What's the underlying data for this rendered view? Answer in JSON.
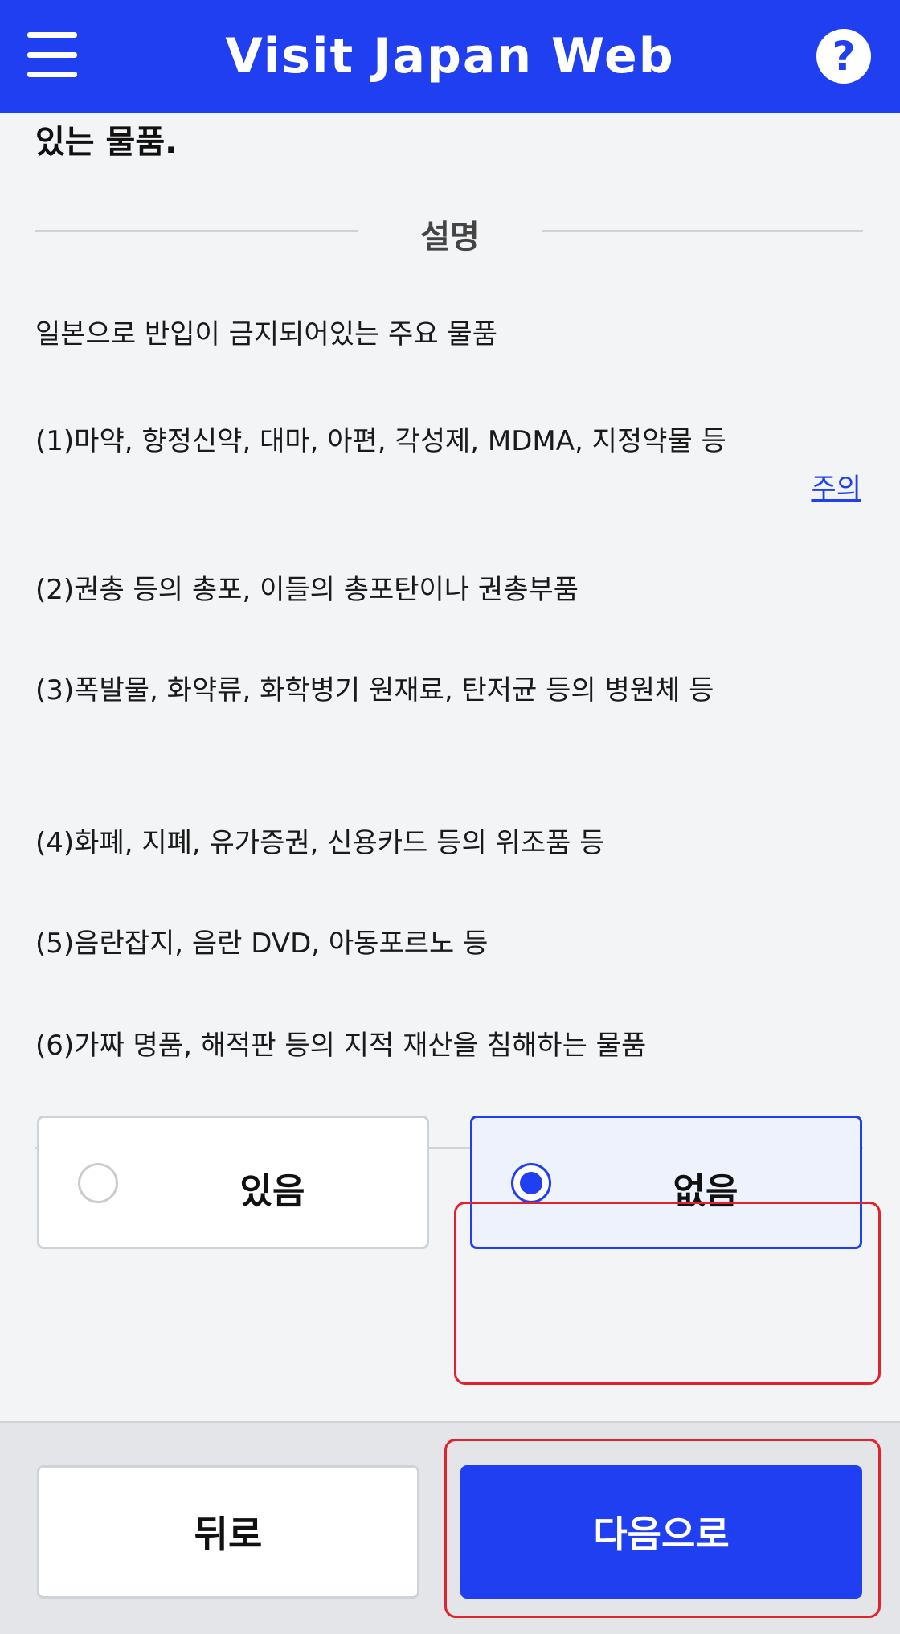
{
  "header": {
    "title": "Visit Japan Web",
    "help_symbol": "?"
  },
  "content": {
    "truncated_heading": "있는 물품.",
    "section_title": "설명",
    "intro": "일본으로 반입이 금지되어있는 주요 물품",
    "items": [
      "(1)마약, 향정신약, 대마, 아편, 각성제, MDMA, 지정약물 등",
      "(2)권총 등의 총포, 이들의 총포탄이나 권총부품",
      "(3)폭발물, 화약류, 화학병기 원재료, 탄저균 등의 병원체 등",
      "(4)화폐, 지폐, 유가증권, 신용카드 등의 위조품 등",
      "(5)음란잡지, 음란 DVD, 아동포르노 등",
      "(6)가짜 명품, 해적판 등의 지적 재산을 침해하는 물품"
    ],
    "caution_link": "주의"
  },
  "choices": {
    "yes_label": "있음",
    "no_label": "없음",
    "selected": "없음"
  },
  "footer": {
    "back_label": "뒤로",
    "next_label": "다음으로"
  },
  "colors": {
    "brand_blue": "#1f3ff0",
    "highlight_red": "#e0232e"
  }
}
